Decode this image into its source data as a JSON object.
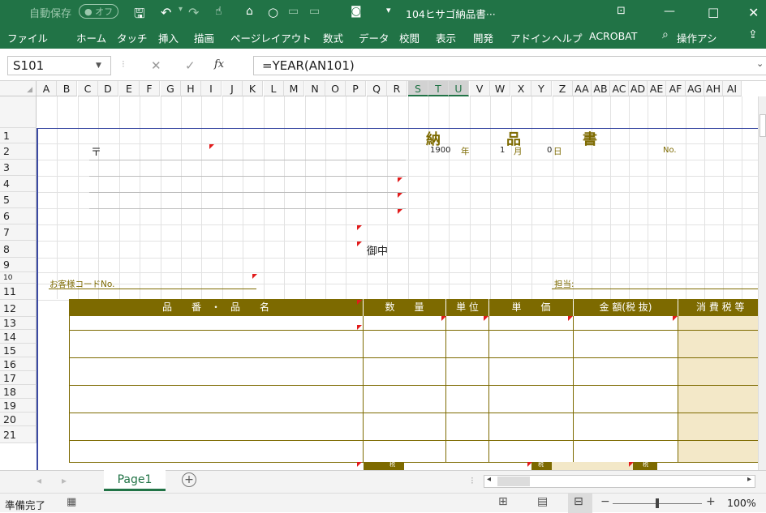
{
  "titlebar": {
    "autosave_label": "自動保存",
    "autosave_state": "オフ",
    "doc_title": "104ヒサゴ納品書···"
  },
  "ribbon": {
    "tabs": [
      "ファイル",
      "ホーム",
      "タッチ",
      "挿入",
      "描画",
      "ページレイアウト",
      "数式",
      "データ",
      "校閲",
      "表示",
      "開発",
      "アドイン",
      "ヘルプ",
      "ACROBAT"
    ],
    "search": "操作アシ"
  },
  "formula_bar": {
    "name_box": "S101",
    "formula": "=YEAR(AN101)"
  },
  "columns": [
    "A",
    "B",
    "C",
    "D",
    "E",
    "F",
    "G",
    "H",
    "I",
    "J",
    "K",
    "L",
    "M",
    "N",
    "O",
    "P",
    "Q",
    "R",
    "S",
    "T",
    "U",
    "V",
    "W",
    "X",
    "Y",
    "Z",
    "AA",
    "AB",
    "AC",
    "AD",
    "AE",
    "AF",
    "AG",
    "AH",
    "AI"
  ],
  "rows": [
    "1",
    "2",
    "3",
    "4",
    "5",
    "6",
    "7",
    "8",
    "9",
    "10",
    "11",
    "12",
    "13",
    "14",
    "15",
    "16",
    "17",
    "18",
    "19",
    "20",
    "21"
  ],
  "sheet": {
    "title_chars": [
      "納",
      "品",
      "書"
    ],
    "postal_mark": "〒",
    "year_value": "1900",
    "year_label": "年",
    "month_value": "1",
    "month_label": "月",
    "day_value": "0",
    "day_label": "日",
    "no_label": "No.",
    "onchu": "御中",
    "customer_code": "お客様コードNo.",
    "tanto": "担当:",
    "headers": {
      "hinban": "品　　番　・　品　　名",
      "suryo": "数　　量",
      "tani": "単 位",
      "tanka": "単　　価",
      "kingaku": "金 額(税 抜)",
      "shohizei": "消 費 税 等"
    },
    "bottom_labels": [
      "税",
      "税",
      "税"
    ]
  },
  "sheet_tabs": {
    "active": "Page1",
    "add": "+"
  },
  "status": {
    "ready": "準備完了",
    "zoom": "100%"
  },
  "colors": {
    "excel_green": "#217346",
    "olive": "#7d6a00",
    "beige": "#f3e8c8"
  }
}
